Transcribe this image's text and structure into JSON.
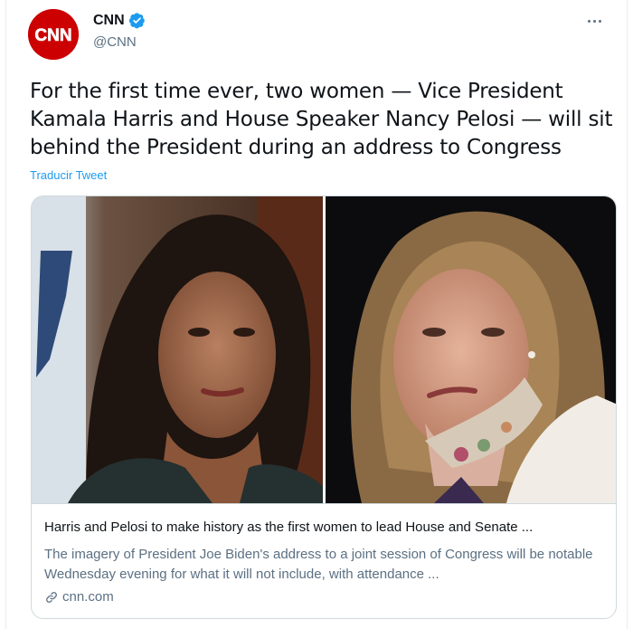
{
  "tweet": {
    "avatar_text": "CNN",
    "display_name": "CNN",
    "handle": "@CNN",
    "more_label": "More",
    "text": "For the first time ever, two women — Vice President Kamala Harris and House Speaker Nancy Pelosi — will sit behind the President during an address to Congress",
    "translate_label": "Traducir Tweet"
  },
  "link_card": {
    "title": "Harris and Pelosi to make history as the first women to lead House and Senate ...",
    "description": "The imagery of President Joe Biden's address to a joint session of Congress will be notable Wednesday evening for what it will not include, with attendance ...",
    "domain": "cnn.com",
    "images": [
      "photo-kamala-harris",
      "photo-nancy-pelosi"
    ]
  },
  "colors": {
    "brand": "#cc0000",
    "verified": "#1d9bf0",
    "link": "#1d9bf0",
    "secondary_text": "#5b7083"
  },
  "icons": {
    "verified": "verified-badge-icon",
    "more": "more-dots-icon",
    "link": "link-icon"
  }
}
